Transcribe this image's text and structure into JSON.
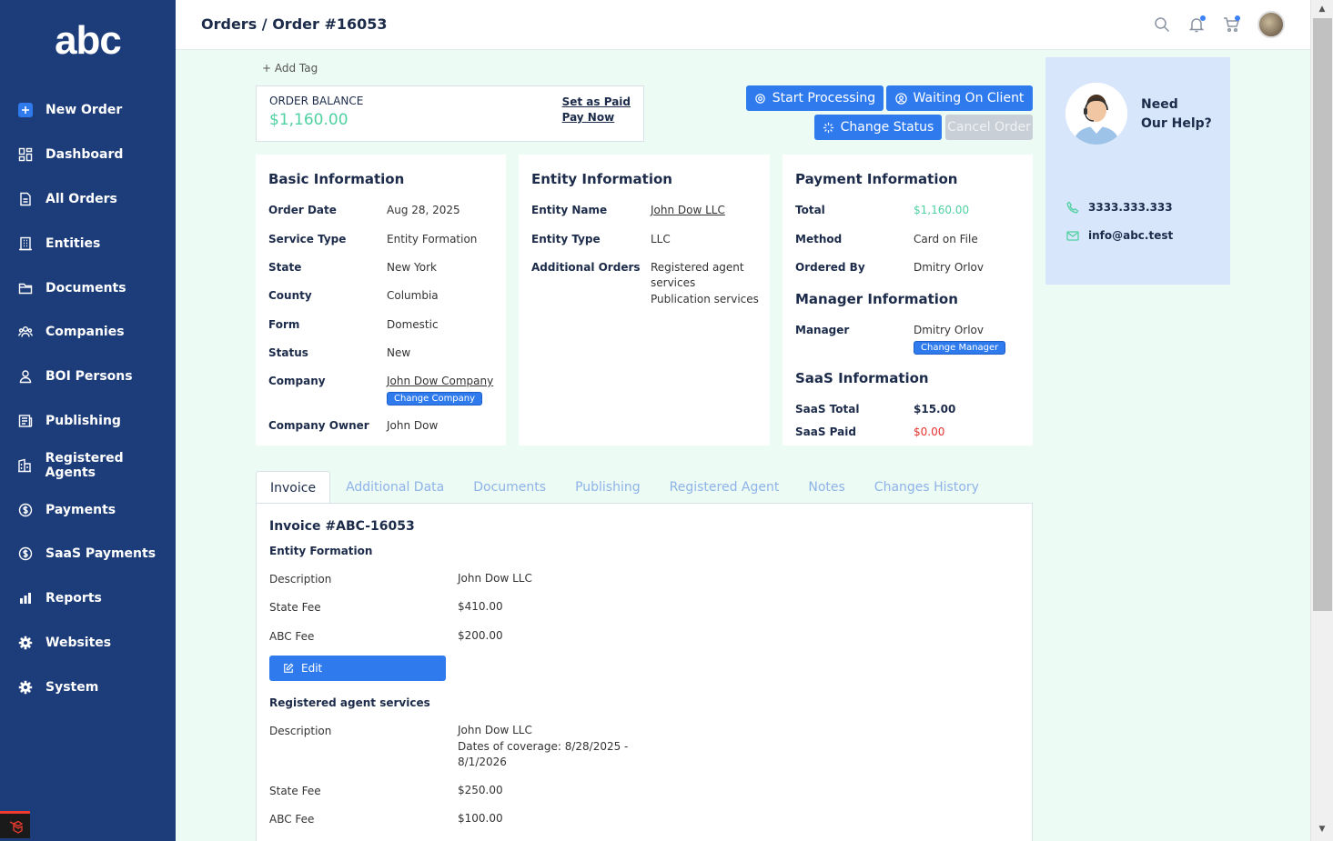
{
  "app": {
    "logo": "abc"
  },
  "sidebar": {
    "items": [
      {
        "label": "New Order",
        "icon": "plus-square-icon"
      },
      {
        "label": "Dashboard",
        "icon": "dashboard-icon"
      },
      {
        "label": "All Orders",
        "icon": "document-icon"
      },
      {
        "label": "Entities",
        "icon": "building-icon"
      },
      {
        "label": "Documents",
        "icon": "folder-icon"
      },
      {
        "label": "Companies",
        "icon": "users-icon"
      },
      {
        "label": "BOI Persons",
        "icon": "person-icon"
      },
      {
        "label": "Publishing",
        "icon": "newspaper-icon"
      },
      {
        "label": "Registered Agents",
        "icon": "bank-icon"
      },
      {
        "label": "Payments",
        "icon": "dollar-circle-icon"
      },
      {
        "label": "SaaS Payments",
        "icon": "dollar-circle-icon"
      },
      {
        "label": "Reports",
        "icon": "bar-chart-icon"
      },
      {
        "label": "Websites",
        "icon": "gear-icon"
      },
      {
        "label": "System",
        "icon": "gear-icon"
      }
    ]
  },
  "header": {
    "breadcrumb": "Orders / Order #16053"
  },
  "order": {
    "add_tag": "+ Add Tag",
    "balance_label": "ORDER BALANCE",
    "balance_amount": "$1,160.00",
    "set_as_paid": "Set as Paid",
    "pay_now": "Pay Now"
  },
  "actions": {
    "start_processing": "Start Processing",
    "waiting_on_client": "Waiting On Client",
    "change_status": "Change Status",
    "cancel_order": "Cancel Order"
  },
  "basic_info": {
    "title": "Basic Information",
    "order_date_label": "Order Date",
    "order_date": "Aug 28, 2025",
    "service_type_label": "Service Type",
    "service_type": "Entity Formation",
    "state_label": "State",
    "state": "New York",
    "county_label": "County",
    "county": "Columbia",
    "form_label": "Form",
    "form": "Domestic",
    "status_label": "Status",
    "status": "New",
    "company_label": "Company",
    "company": "John Dow Company",
    "change_company": "Change Company",
    "owner_label": "Company Owner",
    "owner": "John Dow"
  },
  "entity_info": {
    "title": "Entity Information",
    "name_label": "Entity Name",
    "name": "John Dow LLC",
    "type_label": "Entity Type",
    "type": "LLC",
    "additional_label": "Additional Orders",
    "additional_1": "Registered agent",
    "additional_2": "services",
    "additional_3": "Publication services"
  },
  "payment_info": {
    "title": "Payment Information",
    "total_label": "Total",
    "total": "$1,160.00",
    "method_label": "Method",
    "method": "Card on File",
    "ordered_by_label": "Ordered By",
    "ordered_by": "Dmitry Orlov",
    "manager_title": "Manager Information",
    "manager_label": "Manager",
    "manager": "Dmitry Orlov",
    "change_manager": "Change Manager",
    "saas_title": "SaaS Information",
    "saas_total_label": "SaaS Total",
    "saas_total": "$15.00",
    "saas_paid_label": "SaaS Paid",
    "saas_paid": "$0.00"
  },
  "help": {
    "need_line1": "Need",
    "need_line2": "Our Help?",
    "phone": "3333.333.333",
    "email": "info@abc.test"
  },
  "tabs": [
    "Invoice",
    "Additional Data",
    "Documents",
    "Publishing",
    "Registered Agent",
    "Notes",
    "Changes History"
  ],
  "invoice": {
    "title": "Invoice #ABC-16053",
    "sec1": "Entity Formation",
    "s1_desc_label": "Description",
    "s1_desc": "John Dow LLC",
    "s1_state_label": "State Fee",
    "s1_state": "$410.00",
    "s1_abc_label": "ABC Fee",
    "s1_abc": "$200.00",
    "edit": "Edit",
    "sec2": "Registered agent services",
    "s2_desc_label": "Description",
    "s2_desc_1": "John Dow LLC",
    "s2_desc_2": "Dates of coverage: 8/28/2025 -",
    "s2_desc_3": "8/1/2026",
    "s2_state_label": "State Fee",
    "s2_state": "$250.00",
    "s2_abc_label": "ABC Fee",
    "s2_abc": "$100.00"
  },
  "colors": {
    "sidebar": "#1d3d7a",
    "accent": "#2f7bee",
    "money_green": "#4fd1a1",
    "alert_red": "#e5322d",
    "content_bg": "#ecfbf4"
  }
}
